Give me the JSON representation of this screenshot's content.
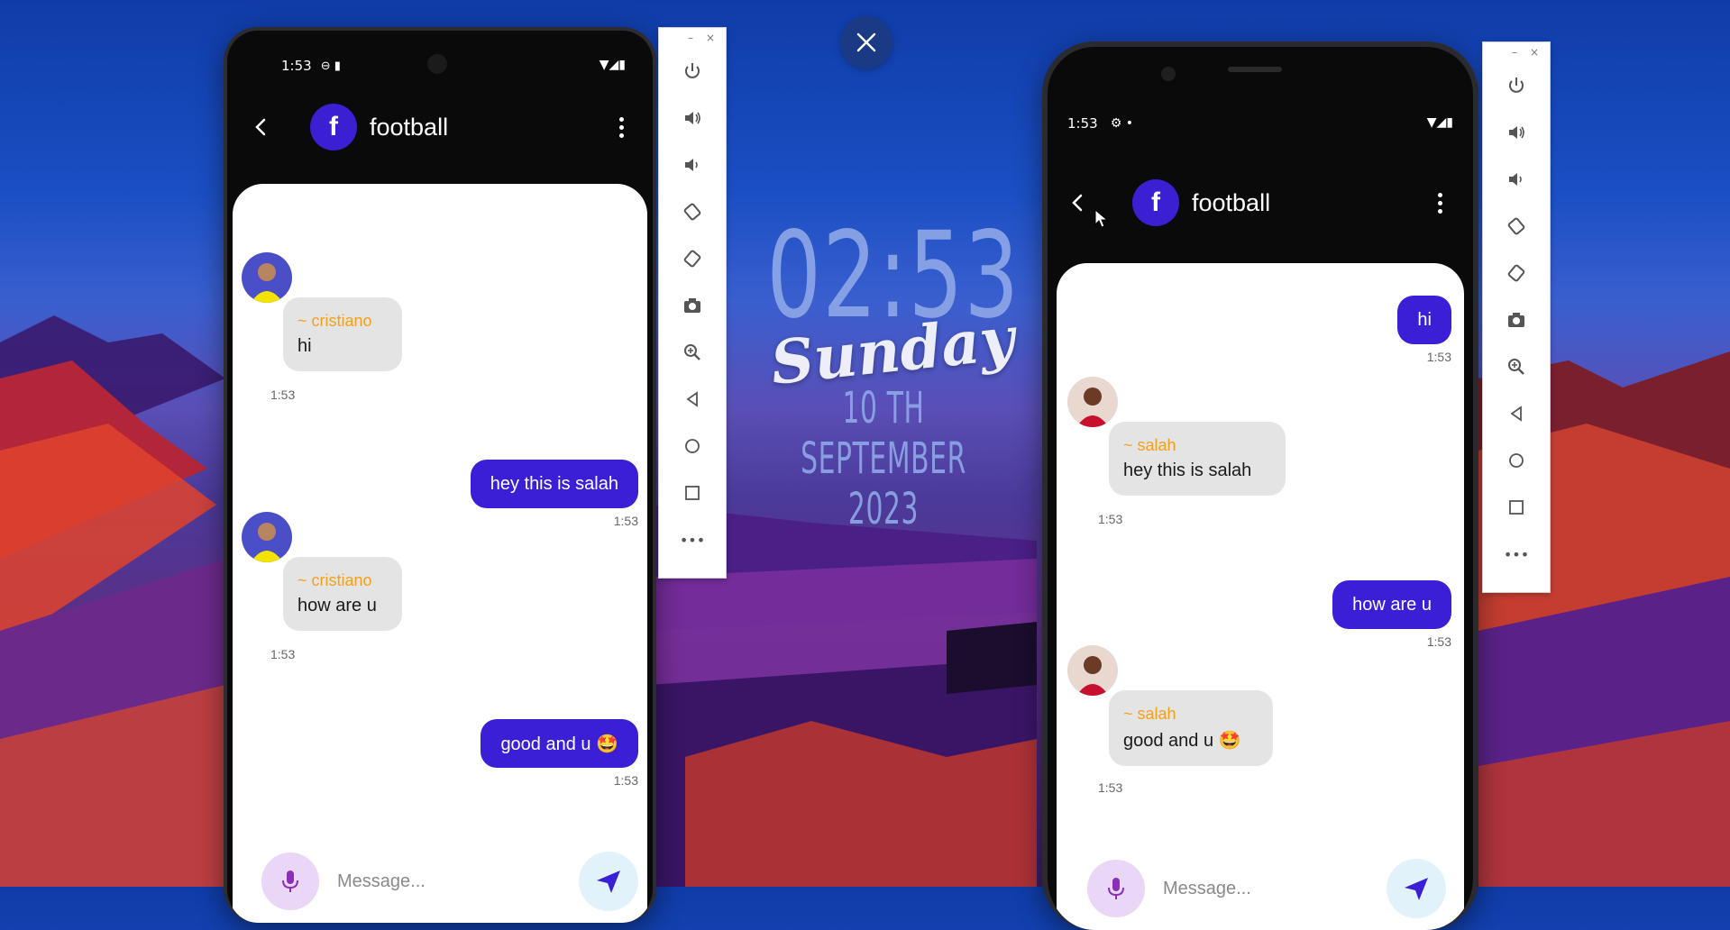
{
  "lockscreen": {
    "time": "02:53",
    "day": "Sunday",
    "date": "10 TH SEPTEMBER 2023"
  },
  "colors": {
    "accent": "#3a1fd6",
    "sender": "#f2a11d",
    "bubble_in": "#e4e4e4"
  },
  "left_phone": {
    "status_time": "1:53",
    "group_name": "football",
    "group_initial": "f",
    "messages": [
      {
        "type": "in",
        "sender": "~ cristiano",
        "text": "hi",
        "time": "1:53"
      },
      {
        "type": "out",
        "text": "hey this is salah",
        "time": "1:53"
      },
      {
        "type": "in",
        "sender": "~ cristiano",
        "text": "how are u",
        "time": "1:53"
      },
      {
        "type": "out",
        "text": "good and u 🤩",
        "time": "1:53"
      }
    ],
    "composer_placeholder": "Message..."
  },
  "right_phone": {
    "status_time": "1:53",
    "group_name": "football",
    "group_initial": "f",
    "messages": [
      {
        "type": "out",
        "text": "hi",
        "time": "1:53"
      },
      {
        "type": "in",
        "sender": "~ salah",
        "text": "hey this is salah",
        "time": "1:53"
      },
      {
        "type": "out",
        "text": "how are u",
        "time": "1:53"
      },
      {
        "type": "in",
        "sender": "~ salah",
        "text": "good and u 🤩",
        "time": "1:53"
      }
    ],
    "composer_placeholder": "Message..."
  },
  "toolbar": {
    "minimize": "–",
    "close": "×",
    "items": [
      "power-icon",
      "volume-up-icon",
      "volume-down-icon",
      "rotate-left-icon",
      "rotate-right-icon",
      "camera-icon",
      "zoom-icon",
      "back-icon",
      "home-icon",
      "overview-icon",
      "more-icon"
    ],
    "more_label": "•••"
  }
}
